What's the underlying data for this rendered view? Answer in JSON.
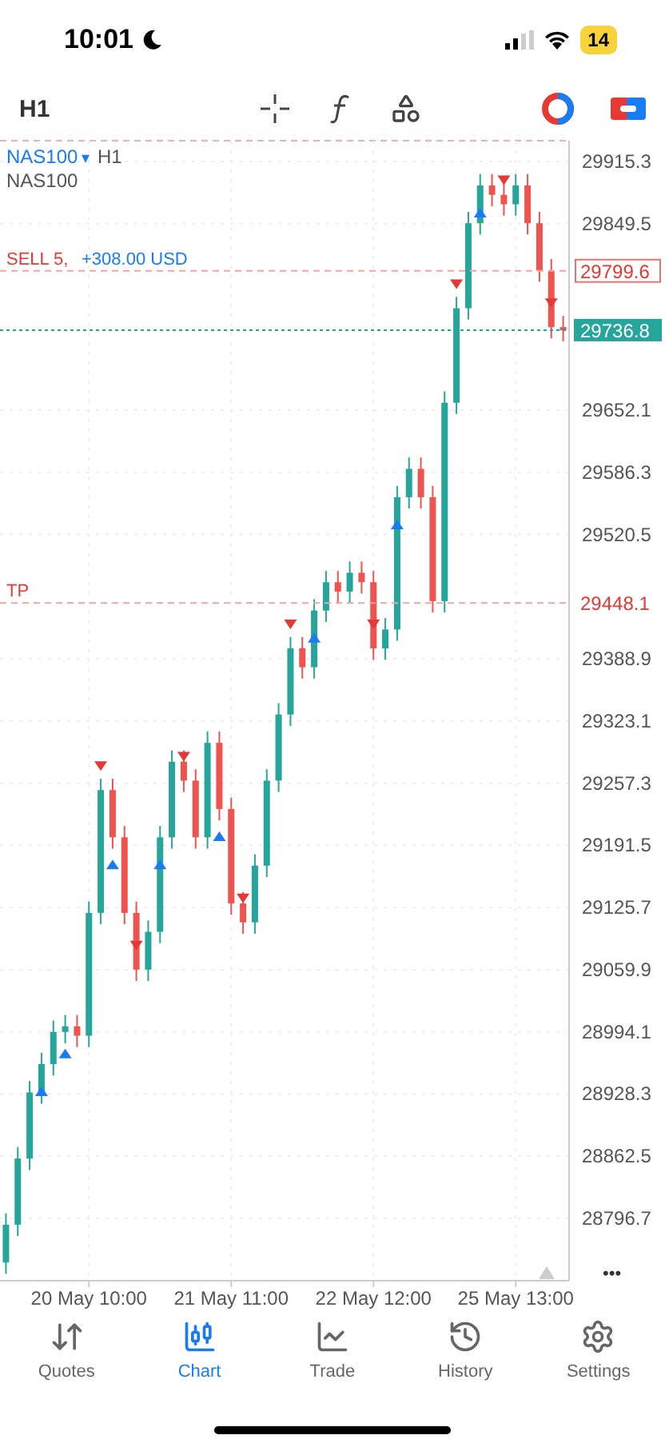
{
  "status_bar": {
    "time": "10:01",
    "battery": "14"
  },
  "toolbar": {
    "timeframe": "H1"
  },
  "chart": {
    "symbol": "NAS100",
    "dropdown": "▾",
    "timeframe": "H1",
    "description": "NAS100",
    "sell_line": {
      "label": "SELL 5,",
      "profit": "+308.00 USD",
      "price": "29799.6"
    },
    "current_price": "29736.8",
    "tp_line": {
      "label": "TP",
      "price": "29448.1"
    },
    "more": "•••",
    "chart_data": {
      "type": "candlestick",
      "grid": true,
      "ylim": [
        28730.7,
        29937.3
      ],
      "categories": [
        null,
        null,
        null,
        null,
        null,
        null,
        null,
        "20 May 10:00",
        null,
        null,
        null,
        null,
        null,
        null,
        null,
        null,
        null,
        null,
        null,
        "21 May 11:00",
        null,
        null,
        null,
        null,
        null,
        null,
        null,
        null,
        null,
        null,
        null,
        "22 May 12:00",
        null,
        null,
        null,
        null,
        null,
        null,
        null,
        null,
        null,
        null,
        null,
        "25 May 13:00",
        null,
        null,
        null,
        null
      ],
      "yticks": [
        29915.3,
        29849.5,
        29652.1,
        29586.3,
        29520.5,
        29388.9,
        29323.1,
        29257.3,
        29191.5,
        29125.7,
        29059.9,
        28994.1,
        28928.3,
        28862.5,
        28796.7
      ],
      "ohlc": [
        [
          28750,
          28802,
          28738,
          28790
        ],
        [
          28790,
          28872,
          28778,
          28860
        ],
        [
          28860,
          28942,
          28848,
          28930
        ],
        [
          28930,
          28972,
          28918,
          28960
        ],
        [
          28960,
          29006,
          28948,
          28994
        ],
        [
          28994,
          29012,
          28982,
          29000
        ],
        [
          29000,
          29012,
          28978,
          28990
        ],
        [
          28990,
          29132,
          28978,
          29120
        ],
        [
          29120,
          29262,
          29108,
          29250
        ],
        [
          29250,
          29262,
          29188,
          29200
        ],
        [
          29200,
          29212,
          29108,
          29120
        ],
        [
          29120,
          29132,
          29048,
          29060
        ],
        [
          29060,
          29112,
          29048,
          29100
        ],
        [
          29100,
          29212,
          29088,
          29200
        ],
        [
          29200,
          29292,
          29188,
          29280
        ],
        [
          29280,
          29292,
          29248,
          29260
        ],
        [
          29260,
          29272,
          29188,
          29200
        ],
        [
          29200,
          29312,
          29188,
          29300
        ],
        [
          29300,
          29312,
          29218,
          29230
        ],
        [
          29230,
          29242,
          29118,
          29130
        ],
        [
          29130,
          29142,
          29098,
          29110
        ],
        [
          29110,
          29182,
          29098,
          29170
        ],
        [
          29170,
          29272,
          29158,
          29260
        ],
        [
          29260,
          29342,
          29248,
          29330
        ],
        [
          29330,
          29412,
          29318,
          29400
        ],
        [
          29400,
          29412,
          29368,
          29380
        ],
        [
          29380,
          29452,
          29368,
          29440
        ],
        [
          29440,
          29482,
          29428,
          29470
        ],
        [
          29470,
          29482,
          29448,
          29460
        ],
        [
          29460,
          29492,
          29448,
          29480
        ],
        [
          29480,
          29492,
          29458,
          29470
        ],
        [
          29470,
          29482,
          29388,
          29400
        ],
        [
          29400,
          29432,
          29388,
          29420
        ],
        [
          29420,
          29572,
          29408,
          29560
        ],
        [
          29560,
          29602,
          29548,
          29590
        ],
        [
          29590,
          29602,
          29548,
          29560
        ],
        [
          29560,
          29572,
          29438,
          29450
        ],
        [
          29450,
          29672,
          29438,
          29660
        ],
        [
          29660,
          29772,
          29648,
          29760
        ],
        [
          29760,
          29862,
          29748,
          29850
        ],
        [
          29850,
          29902,
          29838,
          29890
        ],
        [
          29890,
          29902,
          29868,
          29880
        ],
        [
          29880,
          29892,
          29858,
          29870
        ],
        [
          29870,
          29902,
          29858,
          29890
        ],
        [
          29890,
          29902,
          29838,
          29850
        ],
        [
          29850,
          29862,
          29788,
          29800
        ],
        [
          29800,
          29812,
          29728,
          29740
        ],
        [
          29740,
          29752,
          29725,
          29737
        ]
      ]
    }
  },
  "tabs": [
    {
      "label": "Quotes",
      "selected": false
    },
    {
      "label": "Chart",
      "selected": true
    },
    {
      "label": "Trade",
      "selected": false
    },
    {
      "label": "History",
      "selected": false
    },
    {
      "label": "Settings",
      "selected": false
    }
  ]
}
